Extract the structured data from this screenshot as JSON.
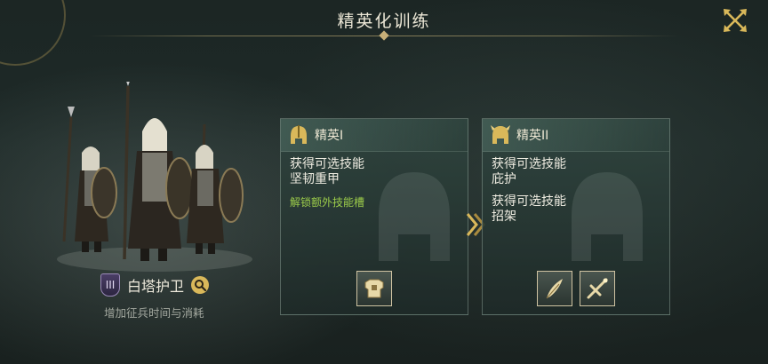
{
  "header": {
    "title": "精英化训练"
  },
  "unit": {
    "tier": "III",
    "name": "白塔护卫",
    "description": "增加征兵时间与消耗"
  },
  "panels": [
    {
      "title": "精英I",
      "skills": [
        {
          "line": "获得可选技能",
          "name": "坚韧重甲"
        }
      ],
      "unlock": "解锁额外技能槽",
      "icons": [
        "armor-icon"
      ]
    },
    {
      "title": "精英II",
      "skills": [
        {
          "line": "获得可选技能",
          "name": "庇护"
        },
        {
          "line": "获得可选技能",
          "name": "招架"
        }
      ],
      "icons": [
        "feather-shield-icon",
        "crossed-swords-icon"
      ]
    }
  ],
  "colors": {
    "accent": "#d9b85a",
    "unlock": "#9ccc4a"
  }
}
